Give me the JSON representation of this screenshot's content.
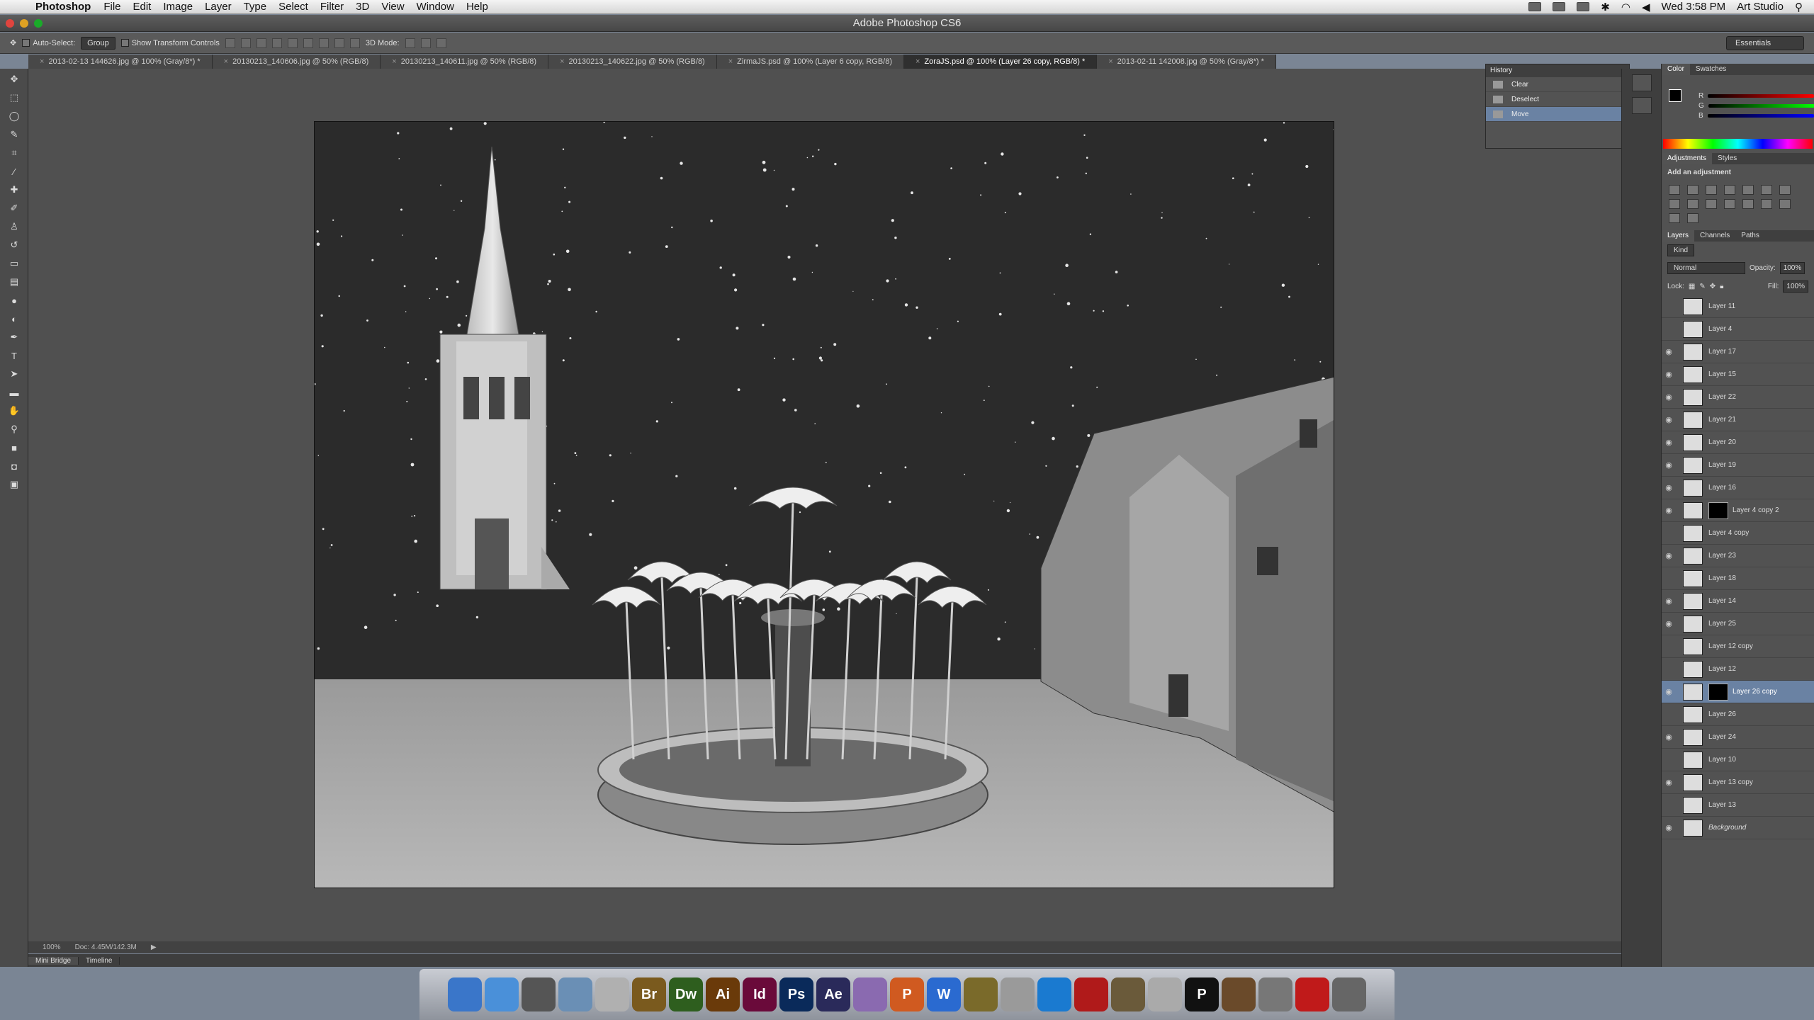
{
  "menubar": {
    "apple": "",
    "app": "Photoshop",
    "items": [
      "File",
      "Edit",
      "Image",
      "Layer",
      "Type",
      "Select",
      "Filter",
      "3D",
      "View",
      "Window",
      "Help"
    ],
    "clock": "Wed 3:58 PM",
    "user": "Art Studio"
  },
  "window": {
    "title": "Adobe Photoshop CS6"
  },
  "options": {
    "auto_select": "Auto-Select:",
    "group": "Group",
    "transform": "Show Transform Controls",
    "mode3d": "3D Mode:",
    "workspace": "Essentials"
  },
  "tabs": [
    "2013-02-13 144626.jpg @ 100% (Gray/8*) *",
    "20130213_140606.jpg @ 50% (RGB/8)",
    "20130213_140611.jpg @ 50% (RGB/8)",
    "20130213_140622.jpg @ 50% (RGB/8)",
    "ZirmaJS.psd @ 100% (Layer 6 copy, RGB/8)",
    "ZoraJS.psd @ 100% (Layer 26 copy, RGB/8) *",
    "2013-02-11 142008.jpg @ 50% (Gray/8*) *"
  ],
  "history": {
    "title": "History",
    "items": [
      "Clear",
      "Deselect",
      "Move"
    ]
  },
  "color_panel": {
    "tabs": [
      "Color",
      "Swatches"
    ],
    "R": "0",
    "G": "0",
    "B": "0"
  },
  "adjustments": {
    "tabs": [
      "Adjustments",
      "Styles"
    ],
    "heading": "Add an adjustment"
  },
  "layers_panel": {
    "tabs": [
      "Layers",
      "Channels",
      "Paths"
    ],
    "kind": "Kind",
    "blend": "Normal",
    "opacity_label": "Opacity:",
    "opacity": "100%",
    "lock": "Lock:",
    "fill_label": "Fill:",
    "fill": "100%",
    "layers": [
      {
        "name": "Layer 11",
        "visible": false
      },
      {
        "name": "Layer 4",
        "visible": false
      },
      {
        "name": "Layer 17",
        "visible": true
      },
      {
        "name": "Layer 15",
        "visible": true
      },
      {
        "name": "Layer 22",
        "visible": true
      },
      {
        "name": "Layer 21",
        "visible": true
      },
      {
        "name": "Layer 20",
        "visible": true
      },
      {
        "name": "Layer 19",
        "visible": true
      },
      {
        "name": "Layer 16",
        "visible": true
      },
      {
        "name": "Layer 4 copy 2",
        "visible": true,
        "mask": true
      },
      {
        "name": "Layer 4 copy",
        "visible": false
      },
      {
        "name": "Layer 23",
        "visible": true
      },
      {
        "name": "Layer 18",
        "visible": false
      },
      {
        "name": "Layer 14",
        "visible": true
      },
      {
        "name": "Layer 25",
        "visible": true
      },
      {
        "name": "Layer 12 copy",
        "visible": false
      },
      {
        "name": "Layer 12",
        "visible": false
      },
      {
        "name": "Layer 26 copy",
        "visible": true,
        "mask": true,
        "selected": true
      },
      {
        "name": "Layer 26",
        "visible": false
      },
      {
        "name": "Layer 24",
        "visible": true
      },
      {
        "name": "Layer 10",
        "visible": false
      },
      {
        "name": "Layer 13 copy",
        "visible": true
      },
      {
        "name": "Layer 13",
        "visible": false
      },
      {
        "name": "Background",
        "visible": true
      }
    ]
  },
  "status": {
    "zoom": "100%",
    "doc": "Doc: 4.45M/142.3M"
  },
  "bottom_tabs": [
    "Mini Bridge",
    "Timeline"
  ],
  "dock": [
    {
      "label": "",
      "color": "#3a76c9"
    },
    {
      "label": "",
      "color": "#4a90d9"
    },
    {
      "label": "",
      "color": "#555"
    },
    {
      "label": "",
      "color": "#6a8fb5"
    },
    {
      "label": "",
      "color": "#b0b0b0"
    },
    {
      "label": "Br",
      "color": "#7a5a1e"
    },
    {
      "label": "Dw",
      "color": "#2e5e1e"
    },
    {
      "label": "Ai",
      "color": "#6a3a0a"
    },
    {
      "label": "Id",
      "color": "#6a0a3a"
    },
    {
      "label": "Ps",
      "color": "#0a2a5a"
    },
    {
      "label": "Ae",
      "color": "#2a2a5a"
    },
    {
      "label": "",
      "color": "#8a6ab0"
    },
    {
      "label": "P",
      "color": "#d05a20"
    },
    {
      "label": "W",
      "color": "#2a6ad0"
    },
    {
      "label": "",
      "color": "#7a6a2a"
    },
    {
      "label": "",
      "color": "#9a9a9a"
    },
    {
      "label": "",
      "color": "#1a7ad0"
    },
    {
      "label": "",
      "color": "#b01a1a"
    },
    {
      "label": "",
      "color": "#6a5a3a"
    },
    {
      "label": "",
      "color": "#aaa"
    },
    {
      "label": "P",
      "color": "#111"
    },
    {
      "label": "",
      "color": "#6a4a2a"
    },
    {
      "label": "",
      "color": "#777"
    },
    {
      "label": "",
      "color": "#c01a1a"
    },
    {
      "label": "",
      "color": "#666"
    }
  ]
}
